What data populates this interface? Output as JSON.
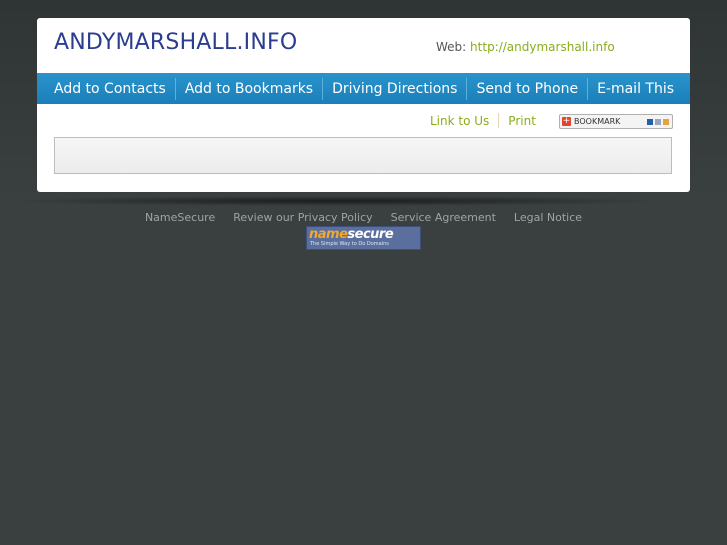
{
  "site": {
    "title": "ANDYMARSHALL.INFO",
    "web_label": "Web:",
    "web_url": "http://andymarshall.info"
  },
  "nav": {
    "items": [
      {
        "label": "Add to Contacts"
      },
      {
        "label": "Add to Bookmarks"
      },
      {
        "label": "Driving Directions"
      },
      {
        "label": "Send to Phone"
      },
      {
        "label": "E-mail This"
      }
    ]
  },
  "tools": {
    "link_to_us": "Link to Us",
    "print": "Print",
    "bookmark_label": "BOOKMARK"
  },
  "footer": {
    "links": [
      {
        "label": "NameSecure"
      },
      {
        "label": "Review our Privacy Policy"
      },
      {
        "label": "Service Agreement"
      },
      {
        "label": "Legal Notice"
      }
    ],
    "logo_name": "name",
    "logo_secure": "secure",
    "logo_tagline": "The Simple Way to Do Domains"
  },
  "colors": {
    "background": "#3a3f40",
    "title": "#2b3d8f",
    "nav_bar": "#2a93cc",
    "link_green": "#8aad1d"
  }
}
